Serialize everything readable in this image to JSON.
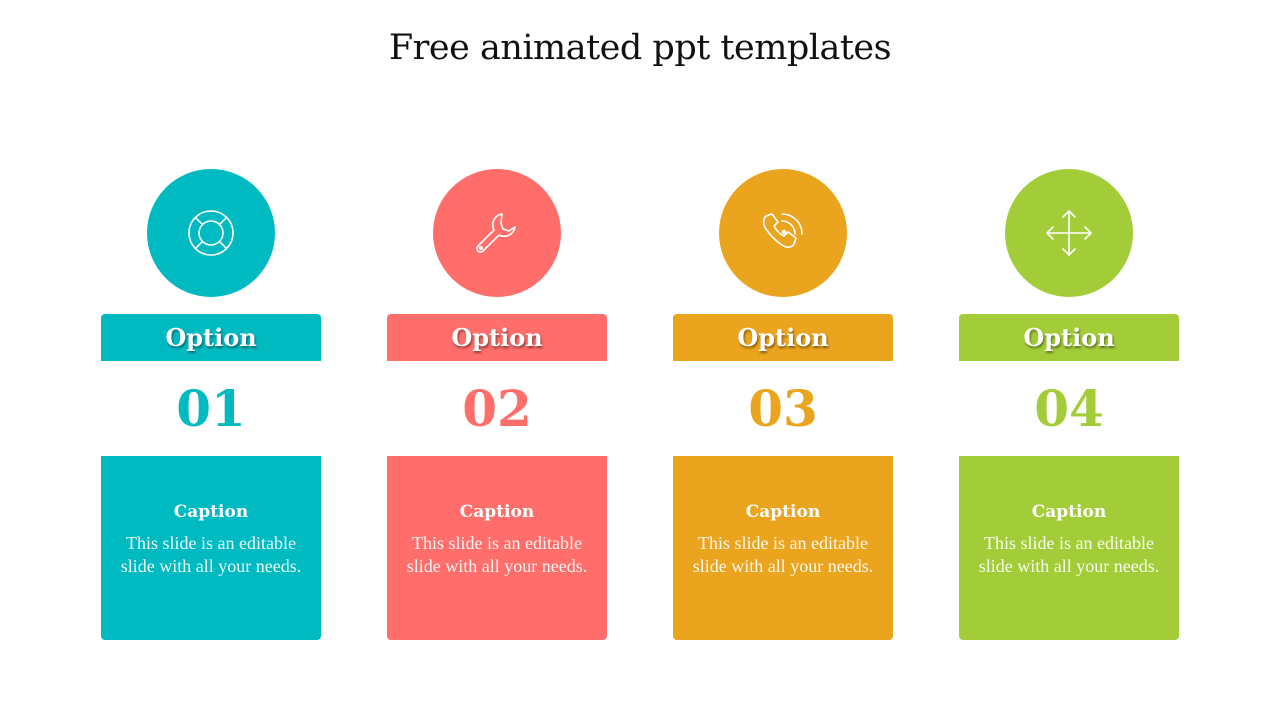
{
  "title": "Free animated ppt templates",
  "items": [
    {
      "icon": "lifebuoy-icon",
      "color": "#00BAC1",
      "option_label": "Option",
      "number": "01",
      "caption_title": "Caption",
      "caption_text": "This slide is an editable slide with all your needs."
    },
    {
      "icon": "wrench-icon",
      "color": "#FF6E6A",
      "option_label": "Option",
      "number": "02",
      "caption_title": "Caption",
      "caption_text": "This slide is an editable slide with all your needs."
    },
    {
      "icon": "phone-call-icon",
      "color": "#EBA41E",
      "option_label": "Option",
      "number": "03",
      "caption_title": "Caption",
      "caption_text": "This slide is an editable slide with all your needs."
    },
    {
      "icon": "move-arrows-icon",
      "color": "#A3CD38",
      "option_label": "Option",
      "number": "04",
      "caption_title": "Caption",
      "caption_text": "This slide is an editable slide with all your needs."
    }
  ]
}
